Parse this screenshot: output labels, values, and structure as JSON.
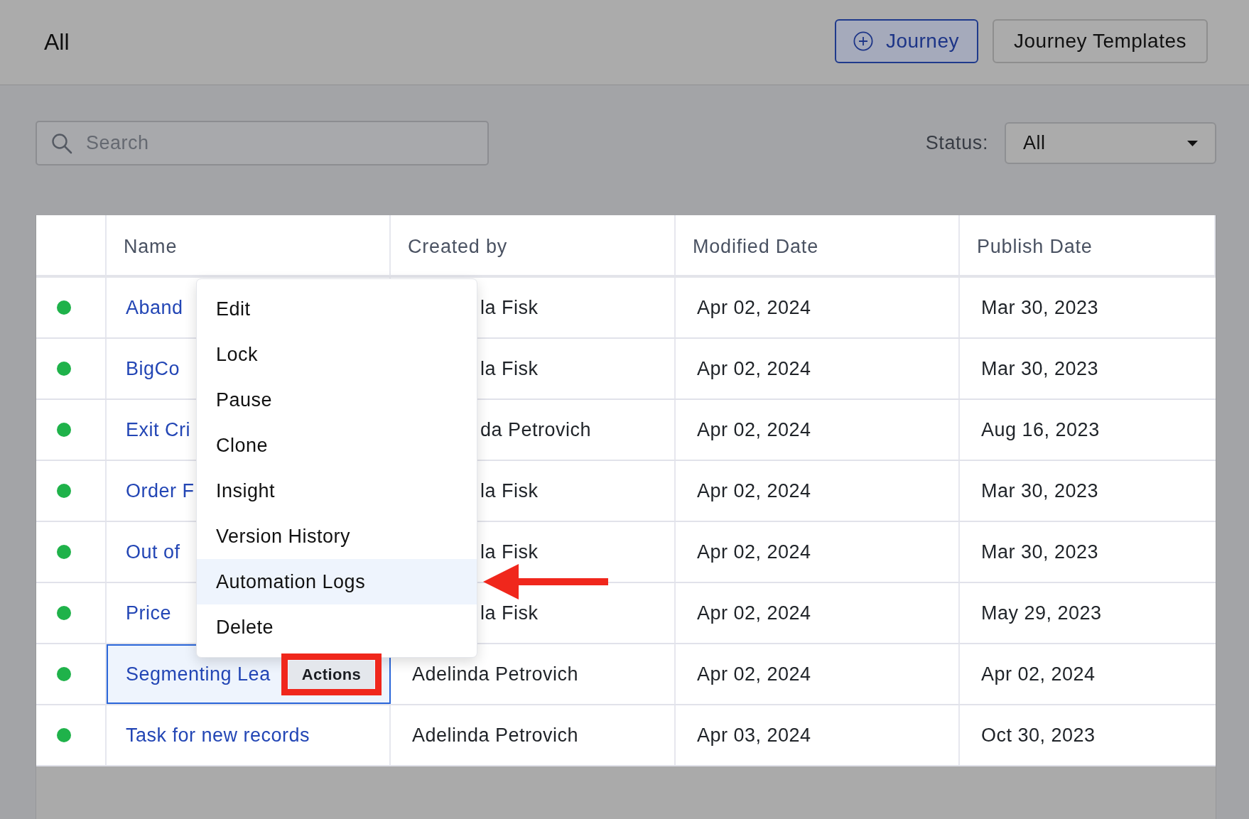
{
  "header": {
    "title": "All",
    "buttons": [
      {
        "kind": "add",
        "label": "Journey"
      },
      {
        "kind": "plain",
        "label": "Journey Templates"
      }
    ]
  },
  "toolbar": {
    "search": {
      "placeholder": "Search"
    },
    "status_filter": {
      "label": "Status:",
      "value": "All"
    }
  },
  "table": {
    "columns": [
      "Name",
      "Created by",
      "Modified Date",
      "Publish Date"
    ],
    "rows": [
      {
        "color": "#1fb24a",
        "name": "Aband",
        "created_by": "la Fisk",
        "modified": "Apr 02, 2024",
        "published": "Mar 30, 2023",
        "selected": false
      },
      {
        "color": "#1fb24a",
        "name": "BigCo",
        "created_by": "la Fisk",
        "modified": "Apr 02, 2024",
        "published": "Mar 30, 2023",
        "selected": false
      },
      {
        "color": "#1fb24a",
        "name": "Exit Cri",
        "created_by": "da Petrovich",
        "modified": "Apr 02, 2024",
        "published": "Aug 16, 2023",
        "selected": false
      },
      {
        "color": "#1fb24a",
        "name": "Order F",
        "created_by": "la Fisk",
        "modified": "Apr 02, 2024",
        "published": "Mar 30, 2023",
        "selected": false
      },
      {
        "color": "#1fb24a",
        "name": "Out of",
        "created_by": "la Fisk",
        "modified": "Apr 02, 2024",
        "published": "Mar 30, 2023",
        "selected": false
      },
      {
        "color": "#1fb24a",
        "name": "Price",
        "created_by": "la Fisk",
        "modified": "Apr 02, 2024",
        "published": "May 29, 2023",
        "selected": false
      },
      {
        "color": "#1fb24a",
        "name": "Segmenting Lea",
        "created_by": "Adelinda Petrovich",
        "modified": "Apr 02, 2024",
        "published": "Apr 02, 2024",
        "selected": true,
        "action_button": {
          "label": "Actions",
          "outlined": true
        }
      },
      {
        "color": "#1fb24a",
        "name": "Task for new records",
        "created_by": "Adelinda Petrovich",
        "modified": "Apr 03, 2024",
        "published": "Oct 30, 2023",
        "selected": false
      }
    ]
  },
  "context_menu": {
    "items": [
      {
        "label": "Edit",
        "highlighted": false,
        "pointed_at": false
      },
      {
        "label": "Lock",
        "highlighted": false,
        "pointed_at": false
      },
      {
        "label": "Pause",
        "highlighted": false,
        "pointed_at": false
      },
      {
        "label": "Clone",
        "highlighted": false,
        "pointed_at": false
      },
      {
        "label": "Insight",
        "highlighted": false,
        "pointed_at": false
      },
      {
        "label": "Version History",
        "highlighted": false,
        "pointed_at": false
      },
      {
        "label": "Automation Logs",
        "highlighted": true,
        "pointed_at": true
      },
      {
        "label": "Delete",
        "highlighted": false,
        "pointed_at": false
      }
    ]
  }
}
